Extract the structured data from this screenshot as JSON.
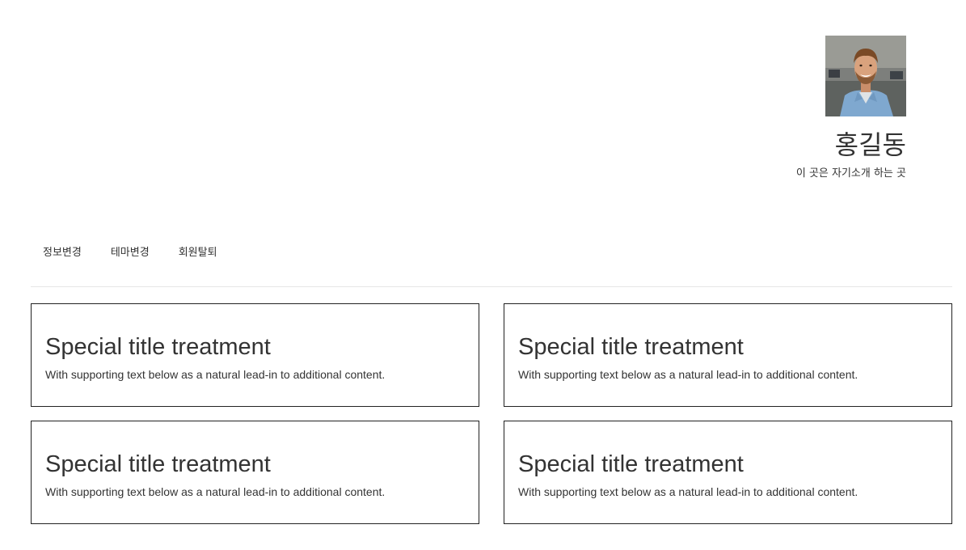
{
  "profile": {
    "name": "홍길동",
    "intro": "이 곳은 자기소개 하는 곳",
    "avatar_alt": "avatar"
  },
  "nav": {
    "items": [
      {
        "label": "정보변경"
      },
      {
        "label": "테마변경"
      },
      {
        "label": "회원탈퇴"
      }
    ]
  },
  "cards": [
    {
      "title": "Special title treatment",
      "text": "With supporting text below as a natural lead-in to additional content."
    },
    {
      "title": "Special title treatment",
      "text": "With supporting text below as a natural lead-in to additional content."
    },
    {
      "title": "Special title treatment",
      "text": "With supporting text below as a natural lead-in to additional content."
    },
    {
      "title": "Special title treatment",
      "text": "With supporting text below as a natural lead-in to additional content."
    }
  ],
  "colors": {
    "text": "#333333",
    "card_border": "#222222",
    "divider": "#e6e6e6",
    "background": "#ffffff"
  }
}
